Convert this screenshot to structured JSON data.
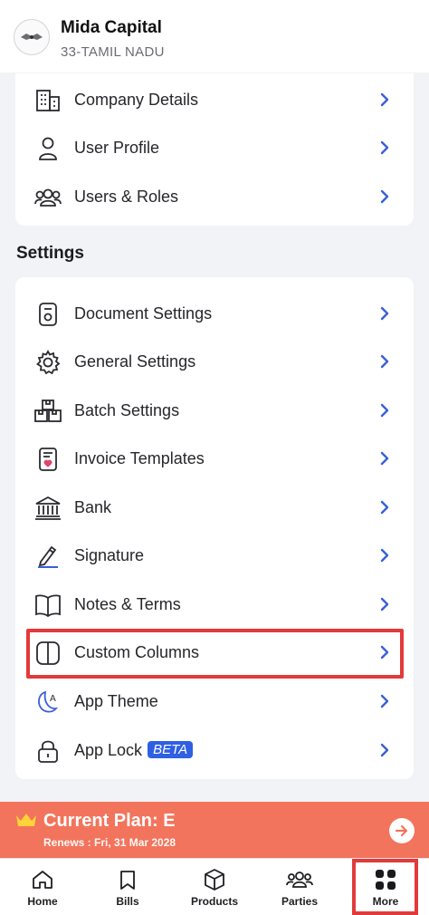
{
  "header": {
    "business_name": "Mida Capital",
    "business_state": "33-TAMIL NADU"
  },
  "account_items": [
    {
      "label": "Company Details",
      "icon": "building-icon"
    },
    {
      "label": "User Profile",
      "icon": "user-icon"
    },
    {
      "label": "Users & Roles",
      "icon": "users-icon"
    }
  ],
  "settings": {
    "title": "Settings",
    "items": [
      {
        "label": "Document Settings",
        "icon": "document-settings-icon"
      },
      {
        "label": "General Settings",
        "icon": "gear-icon"
      },
      {
        "label": "Batch Settings",
        "icon": "boxes-icon"
      },
      {
        "label": "Invoice Templates",
        "icon": "invoice-template-icon"
      },
      {
        "label": "Bank",
        "icon": "bank-icon"
      },
      {
        "label": "Signature",
        "icon": "pen-icon"
      },
      {
        "label": "Notes & Terms",
        "icon": "book-icon"
      },
      {
        "label": "Custom Columns",
        "icon": "columns-icon"
      },
      {
        "label": "App Theme",
        "icon": "theme-icon"
      },
      {
        "label": "App Lock",
        "icon": "lock-icon",
        "badge": "BETA"
      }
    ]
  },
  "plan": {
    "title": "Current Plan: E",
    "renews": "Renews : Fri, 31 Mar 2028"
  },
  "nav": [
    {
      "label": "Home",
      "icon": "home-icon"
    },
    {
      "label": "Bills",
      "icon": "bookmark-icon"
    },
    {
      "label": "Products",
      "icon": "box-icon"
    },
    {
      "label": "Parties",
      "icon": "parties-icon"
    },
    {
      "label": "More",
      "icon": "grid-icon",
      "active": true
    }
  ],
  "colors": {
    "accent": "#2f5fe3",
    "plan_banner": "#f2745c",
    "highlight": "#e23a3a"
  }
}
